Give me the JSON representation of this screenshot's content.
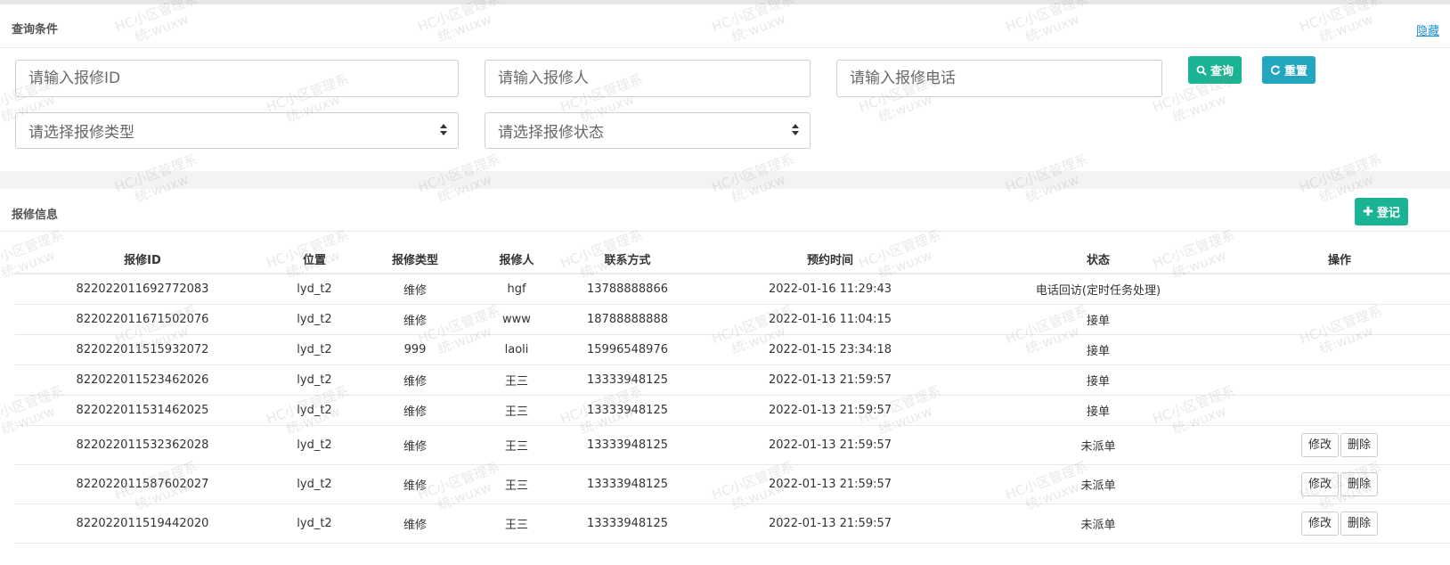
{
  "search_panel": {
    "title": "查询条件",
    "hide_label": "隐藏",
    "repair_id_placeholder": "请输入报修ID",
    "repair_person_placeholder": "请输入报修人",
    "repair_phone_placeholder": "请输入报修电话",
    "repair_type_placeholder": "请选择报修类型",
    "repair_status_placeholder": "请选择报修状态",
    "query_label": "查询",
    "reset_label": "重置"
  },
  "list_panel": {
    "title": "报修信息",
    "add_label": "登记",
    "columns": [
      "报修ID",
      "位置",
      "报修类型",
      "报修人",
      "联系方式",
      "预约时间",
      "状态",
      "操作"
    ],
    "rows": [
      {
        "id": "822022011692772083",
        "location": "lyd_t2",
        "type": "维修",
        "person": "hgf",
        "phone": "13788888866",
        "time": "2022-01-16 11:29:43",
        "status": "电话回访(定时任务处理)",
        "edit": "",
        "delete": ""
      },
      {
        "id": "822022011671502076",
        "location": "lyd_t2",
        "type": "维修",
        "person": "www",
        "phone": "18788888888",
        "time": "2022-01-16 11:04:15",
        "status": "接单",
        "edit": "",
        "delete": ""
      },
      {
        "id": "822022011515932072",
        "location": "lyd_t2",
        "type": "999",
        "person": "laoli",
        "phone": "15996548976",
        "time": "2022-01-15 23:34:18",
        "status": "接单",
        "edit": "",
        "delete": ""
      },
      {
        "id": "822022011523462026",
        "location": "lyd_t2",
        "type": "维修",
        "person": "王三",
        "phone": "13333948125",
        "time": "2022-01-13 21:59:57",
        "status": "接单",
        "edit": "",
        "delete": ""
      },
      {
        "id": "822022011531462025",
        "location": "lyd_t2",
        "type": "维修",
        "person": "王三",
        "phone": "13333948125",
        "time": "2022-01-13 21:59:57",
        "status": "接单",
        "edit": "",
        "delete": ""
      },
      {
        "id": "822022011532362028",
        "location": "lyd_t2",
        "type": "维修",
        "person": "王三",
        "phone": "13333948125",
        "time": "2022-01-13 21:59:57",
        "status": "未派单",
        "edit": "修改",
        "delete": "删除"
      },
      {
        "id": "822022011587602027",
        "location": "lyd_t2",
        "type": "维修",
        "person": "王三",
        "phone": "13333948125",
        "time": "2022-01-13 21:59:57",
        "status": "未派单",
        "edit": "修改",
        "delete": "删除"
      },
      {
        "id": "822022011519442020",
        "location": "lyd_t2",
        "type": "维修",
        "person": "王三",
        "phone": "13333948125",
        "time": "2022-01-13 21:59:57",
        "status": "未派单",
        "edit": "修改",
        "delete": "删除"
      }
    ]
  },
  "watermark": {
    "line1": "HC小区管理系",
    "line2": "统:wuxw"
  },
  "colors": {
    "primary": "#1ab394",
    "info": "#23a6c0",
    "link": "#1a8fd6"
  }
}
